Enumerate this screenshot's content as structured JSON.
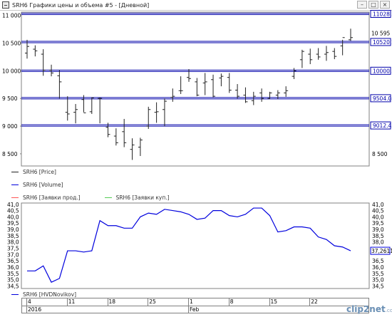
{
  "window": {
    "title": "SRH6 Графики цены и объема #5 - [Дневной]",
    "controls": [
      "–",
      "□",
      "×"
    ]
  },
  "colors": {
    "price": "#222222",
    "levels": "#0000aa",
    "series": "#0000dd",
    "sell": "#ff5555",
    "buy": "#55cc55",
    "frame": "#808080"
  },
  "legend": {
    "price": "SRH6 [Price]",
    "volume": "SRH6 [Volume]",
    "sell": "SRH6 [Заявки прод.]",
    "buy": "SRH6 [Заявки куп.]",
    "indicator": "SRH6 [HVDNovikov]"
  },
  "price_panel": {
    "y_ticks": [
      "11 000",
      "10 500",
      "10 000",
      "9 500",
      "9 000",
      "8 500"
    ],
    "right_ticks": [
      "10 500",
      "10 000",
      "9 500",
      "9 000",
      "8 500"
    ],
    "last_price_label": "10 595",
    "levels": [
      {
        "value": 11028.3,
        "label": "11028.3"
      },
      {
        "value": 10520.2,
        "label": "10520.2"
      },
      {
        "value": 10000.3,
        "label": "10000.3"
      },
      {
        "value": 9504.08,
        "label": "9504.08"
      },
      {
        "value": 9012.43,
        "label": "9012.43"
      }
    ]
  },
  "time_axis": {
    "day_labels": [
      "4",
      "11",
      "18",
      "25",
      "1",
      "8",
      "15",
      "22"
    ],
    "period_labels": [
      "2016",
      "Feb"
    ]
  },
  "chart_data": [
    {
      "type": "ohlc",
      "series_name": "SRH6 [Price]",
      "ylim": [
        8280,
        11060
      ],
      "bars": [
        {
          "o": 10320,
          "h": 10560,
          "l": 10220,
          "c": 10440
        },
        {
          "o": 10390,
          "h": 10460,
          "l": 10260,
          "c": 10360
        },
        {
          "o": 10300,
          "h": 10390,
          "l": 9910,
          "c": 10010
        },
        {
          "o": 10010,
          "h": 10110,
          "l": 9900,
          "c": 9960
        },
        {
          "o": 9910,
          "h": 10010,
          "l": 9500,
          "c": 9800
        },
        {
          "o": 9250,
          "h": 9540,
          "l": 9100,
          "c": 9220
        },
        {
          "o": 9250,
          "h": 9400,
          "l": 9050,
          "c": 9300
        },
        {
          "o": 9480,
          "h": 9560,
          "l": 9250,
          "c": 9240
        },
        {
          "o": 9260,
          "h": 9520,
          "l": 9220,
          "c": 9510
        },
        {
          "o": 9500,
          "h": 9520,
          "l": 9050,
          "c": 9500
        },
        {
          "o": 8980,
          "h": 9060,
          "l": 8800,
          "c": 8850
        },
        {
          "o": 8820,
          "h": 8960,
          "l": 8650,
          "c": 8700
        },
        {
          "o": 8900,
          "h": 9130,
          "l": 8620,
          "c": 8700
        },
        {
          "o": 8580,
          "h": 8780,
          "l": 8390,
          "c": 8660
        },
        {
          "o": 8620,
          "h": 8790,
          "l": 8460,
          "c": 8750
        },
        {
          "o": 9000,
          "h": 9350,
          "l": 8950,
          "c": 9300
        },
        {
          "o": 9250,
          "h": 9430,
          "l": 9060,
          "c": 9260
        },
        {
          "o": 9300,
          "h": 9500,
          "l": 9000,
          "c": 9450
        },
        {
          "o": 9520,
          "h": 9680,
          "l": 9440,
          "c": 9540
        },
        {
          "o": 9640,
          "h": 9900,
          "l": 9580,
          "c": 9640
        },
        {
          "o": 9880,
          "h": 10030,
          "l": 9800,
          "c": 9860
        },
        {
          "o": 9800,
          "h": 9870,
          "l": 9540,
          "c": 9560
        },
        {
          "o": 9780,
          "h": 9960,
          "l": 9560,
          "c": 9800
        },
        {
          "o": 9840,
          "h": 9930,
          "l": 9520,
          "c": 9540
        },
        {
          "o": 9870,
          "h": 9950,
          "l": 9720,
          "c": 9900
        },
        {
          "o": 9880,
          "h": 9960,
          "l": 9600,
          "c": 9650
        },
        {
          "o": 9650,
          "h": 9760,
          "l": 9500,
          "c": 9540
        },
        {
          "o": 9560,
          "h": 9700,
          "l": 9420,
          "c": 9440
        },
        {
          "o": 9460,
          "h": 9620,
          "l": 9380,
          "c": 9540
        },
        {
          "o": 9600,
          "h": 9680,
          "l": 9440,
          "c": 9500
        },
        {
          "o": 9500,
          "h": 9620,
          "l": 9490,
          "c": 9600
        },
        {
          "o": 9560,
          "h": 9650,
          "l": 9490,
          "c": 9600
        },
        {
          "o": 9600,
          "h": 9720,
          "l": 9530,
          "c": 9640
        },
        {
          "o": 9900,
          "h": 10050,
          "l": 9850,
          "c": 10000
        },
        {
          "o": 10200,
          "h": 10380,
          "l": 10050,
          "c": 10350
        },
        {
          "o": 10300,
          "h": 10400,
          "l": 10120,
          "c": 10200
        },
        {
          "o": 10300,
          "h": 10410,
          "l": 10200,
          "c": 10250
        },
        {
          "o": 10300,
          "h": 10450,
          "l": 10180,
          "c": 10330
        },
        {
          "o": 10350,
          "h": 10410,
          "l": 10210,
          "c": 10260
        },
        {
          "o": 10450,
          "h": 10560,
          "l": 10280,
          "c": 10600
        },
        {
          "o": 10560,
          "h": 10760,
          "l": 10540,
          "c": 10600
        }
      ]
    },
    {
      "type": "line",
      "series_name": "SRH6 [HVDNovikov]",
      "ylim": [
        34.3,
        41.1
      ],
      "y_ticks": [
        41.0,
        40.5,
        40.0,
        39.5,
        39.0,
        38.5,
        38.0,
        37.5,
        37.0,
        36.5,
        36.0,
        35.5,
        35.0,
        34.5
      ],
      "y_tick_labels": [
        "41,0",
        "40,5",
        "40,0",
        "39,5",
        "39,0",
        "38,5",
        "38,0",
        "37,5",
        "37,0",
        "36,5",
        "36,0",
        "35,5",
        "35,0",
        "34,5"
      ],
      "last_value_label": "37,2611",
      "values": [
        35.7,
        35.7,
        36.1,
        34.8,
        35.1,
        37.3,
        37.3,
        37.2,
        37.3,
        39.7,
        39.3,
        39.3,
        39.1,
        39.1,
        40.0,
        40.3,
        40.2,
        40.6,
        40.5,
        40.4,
        40.2,
        39.8,
        39.9,
        40.5,
        40.5,
        40.1,
        40.0,
        40.2,
        40.7,
        40.7,
        40.1,
        38.8,
        38.9,
        39.2,
        39.2,
        39.1,
        38.4,
        38.2,
        37.7,
        37.6,
        37.3
      ]
    }
  ]
}
